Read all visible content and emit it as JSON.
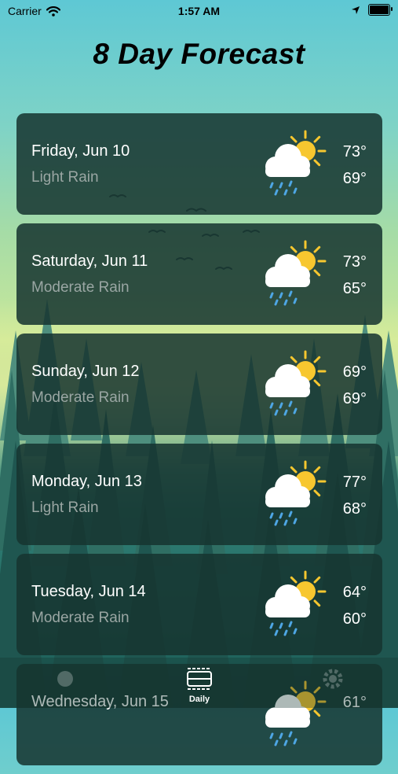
{
  "status_bar": {
    "carrier": "Carrier",
    "time": "1:57 AM"
  },
  "title": "8 Day Forecast",
  "days": [
    {
      "date": "Friday, Jun 10",
      "condition": "Light Rain",
      "high": "73°",
      "low": "69°",
      "icon": "partly-cloudy-rain-icon"
    },
    {
      "date": "Saturday, Jun 11",
      "condition": "Moderate Rain",
      "high": "73°",
      "low": "65°",
      "icon": "partly-cloudy-rain-icon"
    },
    {
      "date": "Sunday, Jun 12",
      "condition": "Moderate Rain",
      "high": "69°",
      "low": "69°",
      "icon": "partly-cloudy-rain-icon"
    },
    {
      "date": "Monday, Jun 13",
      "condition": "Light Rain",
      "high": "77°",
      "low": "68°",
      "icon": "partly-cloudy-rain-icon"
    },
    {
      "date": "Tuesday, Jun 14",
      "condition": "Moderate Rain",
      "high": "64°",
      "low": "60°",
      "icon": "partly-cloudy-rain-icon"
    },
    {
      "date": "Wednesday, Jun 15",
      "condition": "",
      "high": "61°",
      "low": "",
      "icon": "partly-cloudy-rain-icon"
    }
  ],
  "tab_bar": {
    "daily_label": "Daily"
  },
  "colors": {
    "sun": "#f7c72f",
    "rain": "#4ea6e4",
    "card": "#163430",
    "secondary_text": "#9aa6a3"
  }
}
